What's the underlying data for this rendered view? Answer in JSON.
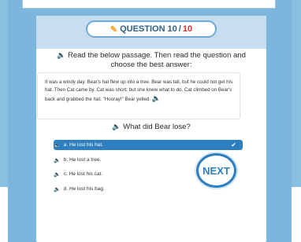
{
  "header": {
    "question_label": "QUESTION",
    "current": "10",
    "separator": "/",
    "total": "10"
  },
  "instruction": "Read the below passage. Then read the question and choose the best answer:",
  "passage": "It was a windy day. Bear's hat flew up into a tree. Bear was tall, but he could not get his hat. Then Cat came by. Cat was short, but she knew what to do. Cat climbed on Bear's back and grabbed the hat. \"Hooray!\" Bear yelled.",
  "question": "What did Bear lose?",
  "options": [
    {
      "label": "a. He lost his hat.",
      "selected": true
    },
    {
      "label": "b. He lost a tree.",
      "selected": false
    },
    {
      "label": "c. He lost his cat.",
      "selected": false
    },
    {
      "label": "d. He lost his bag.",
      "selected": false
    }
  ],
  "next_label": "NEXT",
  "colors": {
    "accent": "#2e7fbf",
    "total_number": "#e03131",
    "background": "#7db6dc"
  }
}
